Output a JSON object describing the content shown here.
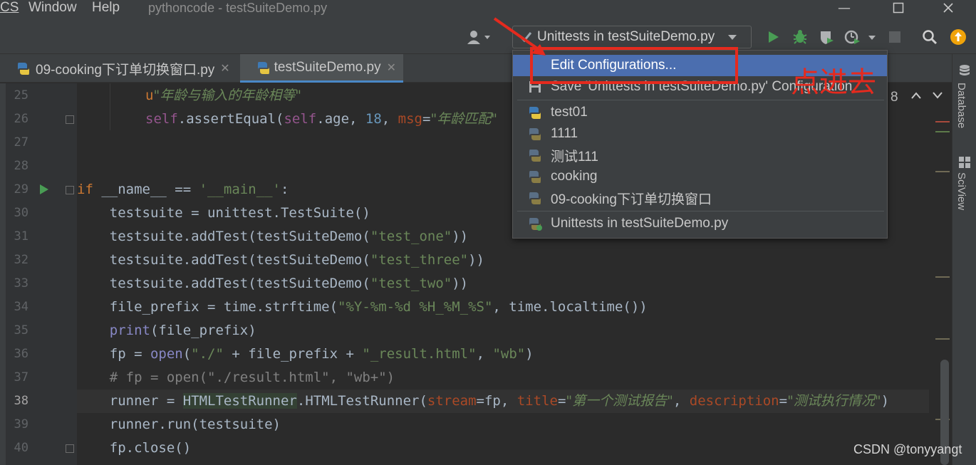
{
  "menubar": {
    "items": [
      {
        "label": "CS"
      },
      {
        "label": "Window"
      },
      {
        "label": "Help"
      }
    ]
  },
  "window": {
    "title": "pythoncode - testSuiteDemo.py"
  },
  "toolbar": {
    "run_config": "Unittests in testSuiteDemo.py",
    "icons": [
      "user-icon",
      "run-icon",
      "debug-icon",
      "coverage-icon",
      "profile-icon",
      "stop-icon",
      "search-icon",
      "update-icon"
    ]
  },
  "tabs": [
    {
      "label": "09-cooking下订单切换窗口.py",
      "active": false
    },
    {
      "label": "testSuiteDemo.py",
      "active": true
    }
  ],
  "editor": {
    "current_line": "38",
    "lines": [
      {
        "no": "25",
        "segments": [
          [
            "u",
            "u"
          ],
          [
            "str cn",
            "\"年龄与输入的年龄相等\""
          ]
        ]
      },
      {
        "no": "26",
        "segments": [
          [
            "self",
            "self"
          ],
          [
            "",
            ".assertEqual("
          ],
          [
            "self",
            "self"
          ],
          [
            "",
            ".age, "
          ],
          [
            "num",
            "18"
          ],
          [
            "",
            ", "
          ],
          [
            "kwarg",
            "msg"
          ],
          [
            "",
            "="
          ],
          [
            "str cn",
            "\"年龄匹配\""
          ]
        ]
      },
      {
        "no": "27",
        "segments": []
      },
      {
        "no": "28",
        "segments": []
      },
      {
        "no": "29",
        "segments": [
          [
            "kw",
            "if "
          ],
          [
            "",
            "__name__ == "
          ],
          [
            "str",
            "'__main__'"
          ],
          [
            "",
            ":"
          ]
        ]
      },
      {
        "no": "30",
        "segments": [
          [
            "",
            "    testsuite = unittest.TestSuite()"
          ]
        ]
      },
      {
        "no": "31",
        "segments": [
          [
            "",
            "    testsuite.addTest(testSuiteDemo("
          ],
          [
            "str",
            "\"test_one\""
          ],
          [
            "",
            "))"
          ]
        ]
      },
      {
        "no": "32",
        "segments": [
          [
            "",
            "    testsuite.addTest(testSuiteDemo("
          ],
          [
            "str",
            "\"test_three\""
          ],
          [
            "",
            "))"
          ]
        ]
      },
      {
        "no": "33",
        "segments": [
          [
            "",
            "    testsuite.addTest(testSuiteDemo("
          ],
          [
            "str",
            "\"test_two\""
          ],
          [
            "",
            "))"
          ]
        ]
      },
      {
        "no": "34",
        "segments": [
          [
            "",
            "    file_prefix = time.strftime("
          ],
          [
            "str",
            "\"%Y-%m-%d %H_%M_%S\""
          ],
          [
            "",
            ", time.localtime())"
          ]
        ]
      },
      {
        "no": "35",
        "segments": [
          [
            "",
            "    "
          ],
          [
            "bi",
            "print"
          ],
          [
            "",
            "(file_prefix)"
          ]
        ]
      },
      {
        "no": "36",
        "segments": [
          [
            "",
            "    fp = "
          ],
          [
            "bi",
            "open"
          ],
          [
            "",
            "("
          ],
          [
            "str",
            "\"./\""
          ],
          [
            "",
            " + file_prefix + "
          ],
          [
            "str",
            "\"_result.html\""
          ],
          [
            "",
            ", "
          ],
          [
            "str",
            "\"wb\""
          ],
          [
            "",
            ")"
          ]
        ]
      },
      {
        "no": "37",
        "segments": [
          [
            "cmt",
            "    # fp = open(\"./result.html\", \"wb+\")"
          ]
        ]
      },
      {
        "no": "38",
        "segments": [
          [
            "",
            "    "
          ],
          [
            "hl",
            "HTMLTestRunner"
          ],
          [
            "",
            ".HTMLTestRunner("
          ],
          [
            "kwarg",
            "stream"
          ],
          [
            "",
            "=fp, "
          ],
          [
            "kwarg",
            "title"
          ],
          [
            "",
            "="
          ],
          [
            "str cn",
            "\"第一个测试报告\""
          ],
          [
            "",
            ", "
          ],
          [
            "kwarg",
            "description"
          ],
          [
            "",
            "="
          ],
          [
            "str cn",
            "\"测试执行情况\""
          ],
          [
            "",
            ")"
          ]
        ]
      },
      {
        "no": "39",
        "segments": [
          [
            "",
            "    runner.run(testsuite)"
          ]
        ]
      },
      {
        "no": "40",
        "segments": [
          [
            "",
            "    fp.close()"
          ]
        ]
      }
    ]
  },
  "line38_prefix": "    runner = ",
  "dropdown": {
    "items": [
      {
        "label": "Edit Configurations...",
        "icon": "none",
        "selected": true
      },
      {
        "label": "Save 'Unittests in testSuiteDemo.py' Configuration",
        "icon": "save-icon",
        "selected": false
      },
      {
        "label": "test01",
        "icon": "python-icon",
        "selected": false
      },
      {
        "label": "1111",
        "icon": "python-faded-icon",
        "selected": false
      },
      {
        "label": "测试111",
        "icon": "python-faded-icon",
        "selected": false
      },
      {
        "label": "cooking",
        "icon": "python-faded-icon",
        "selected": false
      },
      {
        "label": "09-cooking下订单切换窗口",
        "icon": "python-faded-icon",
        "selected": false
      },
      {
        "label": "Unittests in testSuiteDemo.py",
        "icon": "unittest-icon",
        "selected": false
      }
    ]
  },
  "side_panel": {
    "items": [
      {
        "label": "Database"
      },
      {
        "label": "SciView"
      }
    ]
  },
  "find_count": "8",
  "annotation": {
    "text": "点进去"
  },
  "watermark": "CSDN @tonyyangt",
  "colors": {
    "accent": "#4b6eaf",
    "annotation": "#e52a1e",
    "background": "#2b2b2b",
    "run": "#499c54"
  }
}
